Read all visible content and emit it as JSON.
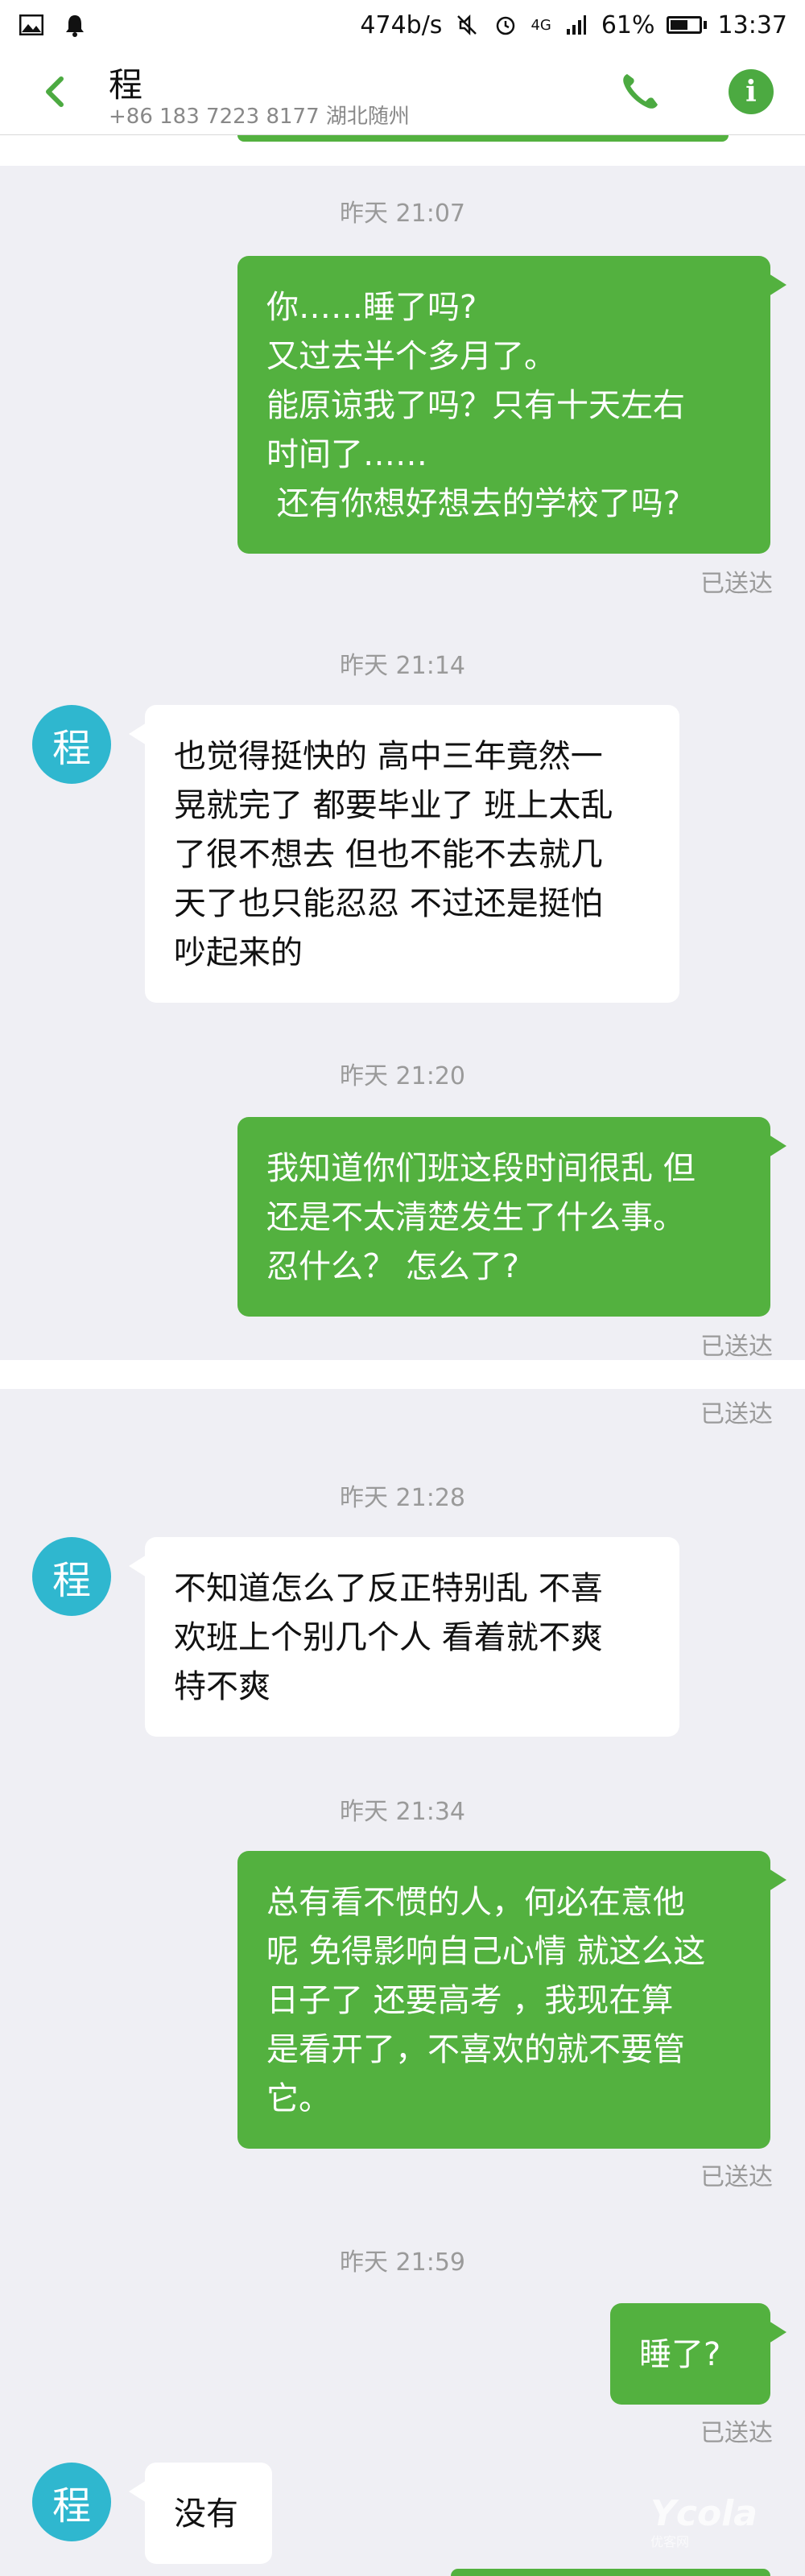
{
  "statusbar": {
    "net_speed": "474b/s",
    "network": "4G",
    "battery_text": "61%",
    "battery_level": 0.61,
    "time": "13:37"
  },
  "header": {
    "contact_name": "程",
    "contact_sub": "+86 183 7223 8177 湖北随州",
    "info_glyph": "i"
  },
  "colors": {
    "sent_bubble": "#53b13f",
    "avatar": "#2fb7cf",
    "accent": "#4caa41"
  },
  "conversation": {
    "avatar_char": "程",
    "t1": "昨天 21:07",
    "m1": "你……睡了吗?\n又过去半个多月了。\n能原谅我了吗？只有十天左右\n时间了……\n 还有你想好想去的学校了吗?",
    "s1": "已送达",
    "t2": "昨天 21:14",
    "m2": "也觉得挺快的 高中三年竟然一\n晃就完了 都要毕业了 班上太乱\n了很不想去 但也不能不去就几\n天了也只能忍忍 不过还是挺怕\n吵起来的",
    "t3": "昨天 21:20",
    "m3": "我知道你们班这段时间很乱 但\n还是不太清楚发生了什么事。\n忍什么？ 怎么了?",
    "s3": "已送达",
    "s3b": "已送达",
    "t4": "昨天 21:28",
    "m4": "不知道怎么了反正特别乱 不喜\n欢班上个别几个人 看着就不爽\n特不爽",
    "t5": "昨天 21:34",
    "m5": "总有看不惯的人，何必在意他\n呢 免得影响自己心情 就这么这\n日子了 还要高考 ，我现在算\n是看开了，不喜欢的就不要管\n它。",
    "s5": "已送达",
    "t6": "昨天 21:59",
    "m6": "睡了?",
    "s6": "已送达",
    "m7": "没有"
  },
  "watermark": {
    "text": "Ycola",
    "sub": "优客网"
  }
}
